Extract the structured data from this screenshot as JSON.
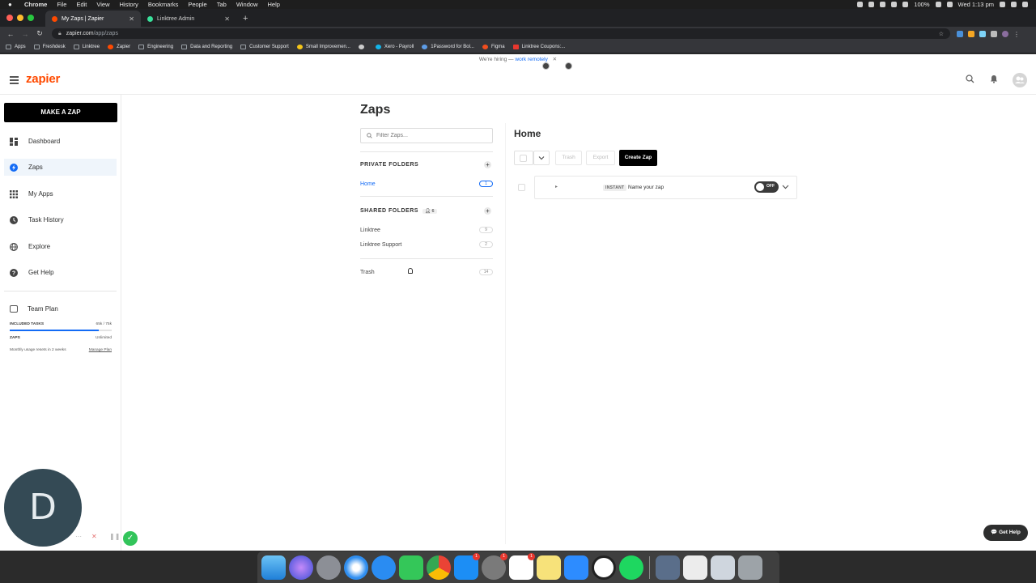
{
  "menubar": {
    "app": "Chrome",
    "items": [
      "File",
      "Edit",
      "View",
      "History",
      "Bookmarks",
      "People",
      "Tab",
      "Window",
      "Help"
    ],
    "battery": "100%",
    "clock": "Wed 1:13 pm"
  },
  "tabs": [
    {
      "title": "My Zaps | Zapier",
      "color": "#ff4a00"
    },
    {
      "title": "Linktree Admin",
      "color": "#39e09b"
    }
  ],
  "address": {
    "host": "zapier.com",
    "path": "/app/zaps"
  },
  "bookmarks": [
    "Apps",
    "Freshdesk",
    "Linktree",
    "Zapier",
    "Engineering",
    "Data and Reporting",
    "Customer Support",
    "Small Improvemen...",
    "Xero - Payroll",
    "1Password for Bol...",
    "Figma",
    "Linktree Coupons:..."
  ],
  "hiring": {
    "text": "We're hiring —",
    "link": "work remotely",
    "close": "✕"
  },
  "brand": {
    "logo": "zapier",
    "accent": "#ff4a00",
    "link": "#136bf5"
  },
  "sidebar": {
    "make_zap": "MAKE A ZAP",
    "items": [
      {
        "label": "Dashboard",
        "icon": "dashboard-icon"
      },
      {
        "label": "Zaps",
        "icon": "zap-icon"
      },
      {
        "label": "My Apps",
        "icon": "apps-grid-icon"
      },
      {
        "label": "Task History",
        "icon": "clock-icon"
      },
      {
        "label": "Explore",
        "icon": "globe-icon"
      },
      {
        "label": "Get Help",
        "icon": "help-icon"
      }
    ],
    "plan": {
      "title": "Team Plan",
      "tasks_label": "INCLUDED TASKS",
      "tasks_value": "65k / 75k",
      "tasks_fraction": 0.87,
      "zaps_label": "ZAPS",
      "zaps_value": "Unlimited",
      "reset_text": "Monthly usage resets in 2 weeks",
      "manage": "Manage Plan"
    }
  },
  "folders": {
    "title": "Zaps",
    "filter_placeholder": "Filter Zaps...",
    "private_heading": "PRIVATE FOLDERS",
    "private": [
      {
        "name": "Home",
        "count": "1"
      }
    ],
    "shared_heading": "SHARED FOLDERS",
    "shared_members": "6",
    "shared": [
      {
        "name": "Linktree",
        "count": "9"
      },
      {
        "name": "Linktree Support",
        "count": "2"
      }
    ],
    "trash": {
      "name": "Trash",
      "count": "14"
    }
  },
  "main": {
    "title": "Home",
    "trash_btn": "Trash",
    "export_btn": "Export",
    "create_btn": "Create Zap",
    "zaps": [
      {
        "badge": "INSTANT",
        "name": "Name your zap",
        "state": "OFF"
      }
    ]
  },
  "help_button": "💬 Get Help",
  "recorder": {
    "avatar_letter": "D"
  }
}
